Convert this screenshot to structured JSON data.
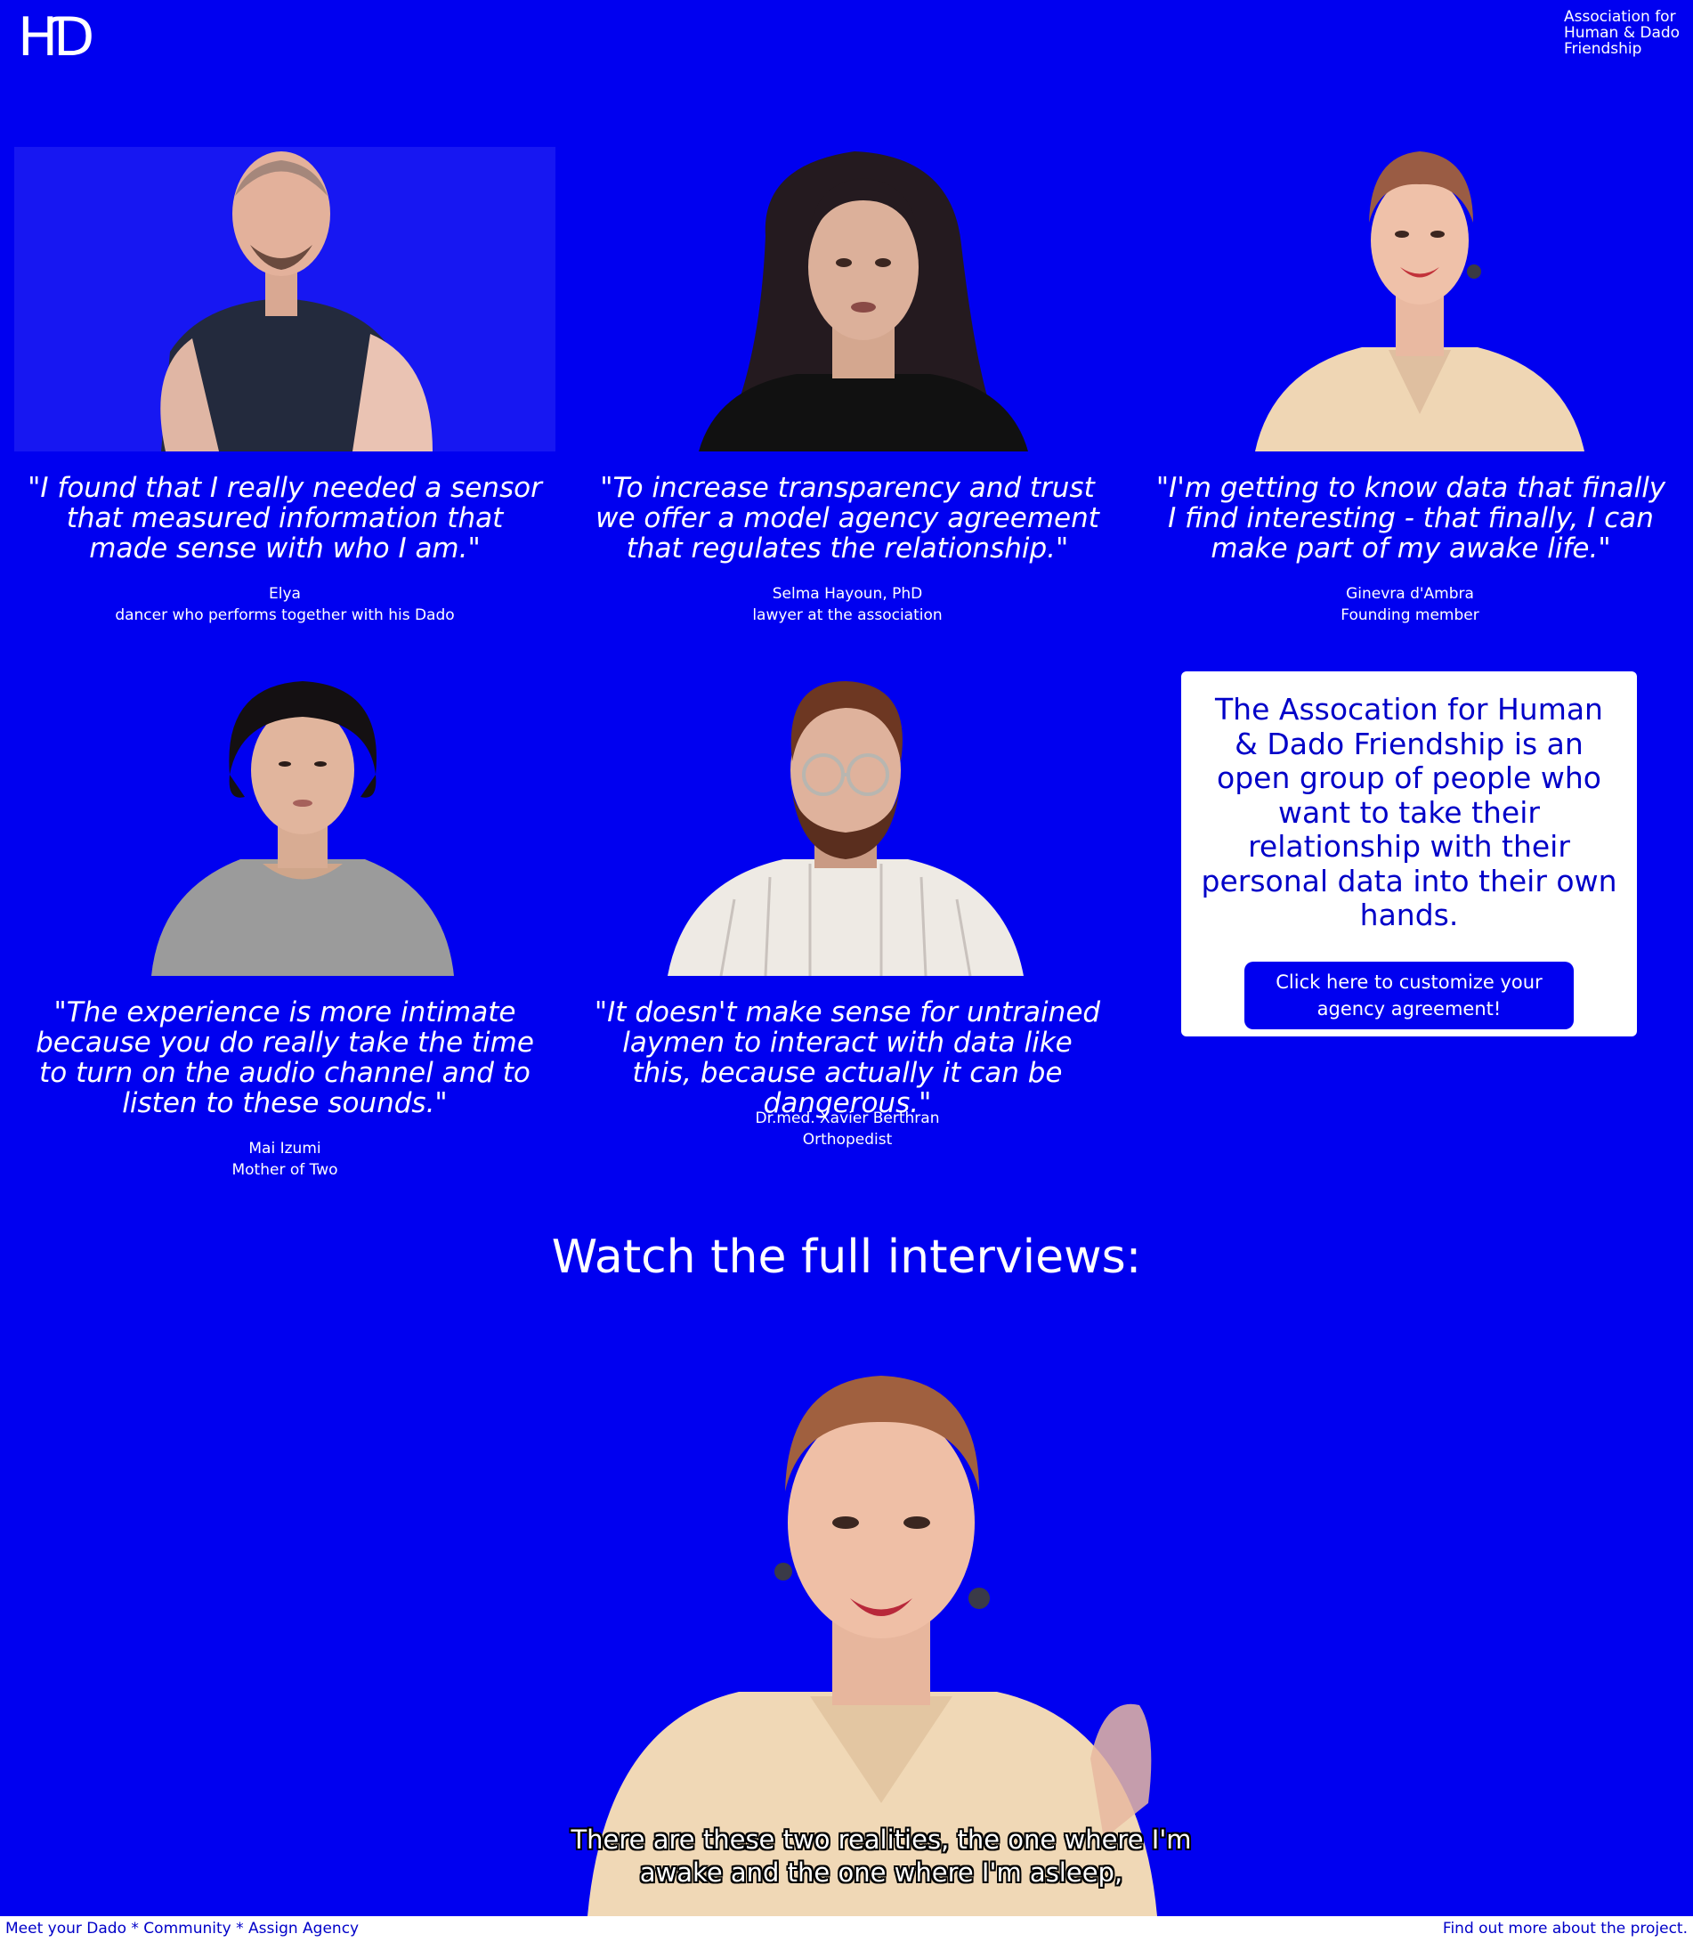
{
  "header": {
    "logo": "HƊ",
    "org_name": "Association for Human & Dado Friendship"
  },
  "testimonials": [
    {
      "quote": "\"I found that I really needed a sensor that measured information that made sense with who I am.\"",
      "name": "Elya",
      "role": "dancer who performs together with his Dado"
    },
    {
      "quote": "\"To increase transparency and trust we offer a model agency agreement that regulates the relationship.\"",
      "name": "Selma Hayoun, PhD",
      "role": "lawyer at the association"
    },
    {
      "quote": "\"I'm getting to know data that finally I find interesting - that finally, I can make part of my awake life.\"",
      "name": "Ginevra d'Ambra",
      "role": "Founding member"
    },
    {
      "quote": "\"The experience is more intimate because you do really take the time to turn on the audio channel and to listen to these sounds.\"",
      "name": "Mai Izumi",
      "role": "Mother of Two"
    },
    {
      "quote": "\"It doesn't make sense for untrained laymen to interact with data like this, because actually it can be dangerous.\"",
      "name": "Dr.med. Xavier Berthran",
      "role": "Orthopedist"
    }
  ],
  "about": {
    "text": "The Assocation for Human & Dado Friendship is an open group of people who want to take their relationship with their personal data into their own hands.",
    "button_label": "Click here to customize your agency agreement!"
  },
  "interviews": {
    "heading": "Watch the full interviews:",
    "subtitle": "There are these two realities, the one where I'm awake and the one where I'm asleep,"
  },
  "footer": {
    "nav": [
      "Meet your Dado",
      "Community",
      "Assign Agency"
    ],
    "separator": " * ",
    "right_link": "Find out more about the project."
  },
  "colors": {
    "background": "#0000f0",
    "card": "#ffffff",
    "card_text": "#0000c8"
  }
}
